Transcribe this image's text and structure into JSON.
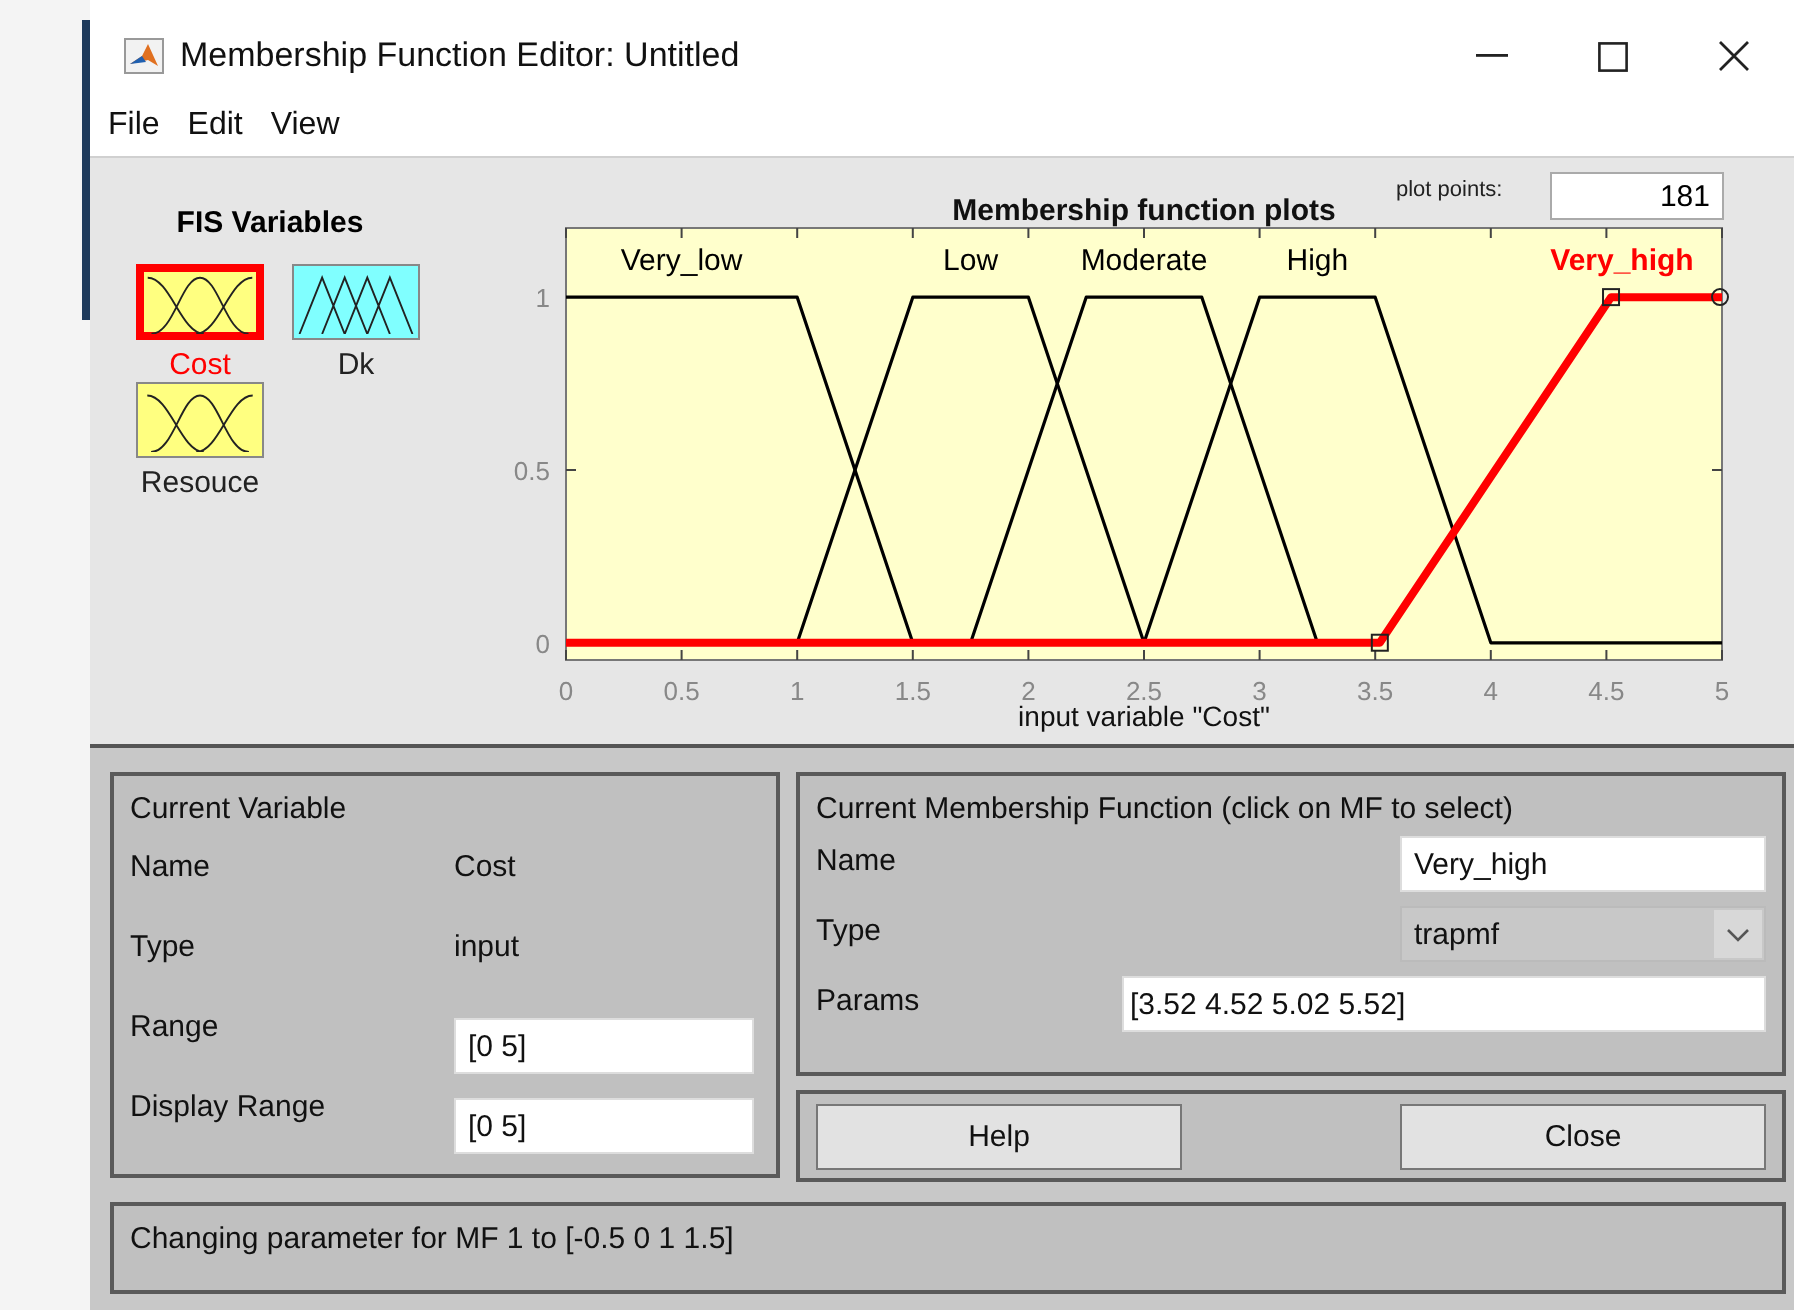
{
  "window": {
    "title": "Membership Function Editor: Untitled"
  },
  "menu": [
    {
      "label": "File"
    },
    {
      "label": "Edit"
    },
    {
      "label": "View"
    }
  ],
  "fis_variables": {
    "title": "FIS Variables",
    "items": [
      {
        "name": "Cost",
        "kind": "input",
        "selected": true
      },
      {
        "name": "Dk",
        "kind": "output",
        "selected": false
      },
      {
        "name": "Resouce",
        "kind": "input",
        "selected": false
      }
    ]
  },
  "plot_points": {
    "label": "plot points:",
    "value": "181"
  },
  "chart_data": {
    "type": "line",
    "title": "Membership function plots",
    "xlabel": "input variable \"Cost\"",
    "x": [
      0,
      1,
      1.5,
      1.75,
      2,
      2.25,
      2.5,
      2.75,
      3,
      3.25,
      3.5,
      3.52,
      4,
      4.52,
      5
    ],
    "series": [
      {
        "name": "Very_low",
        "color": "#000000",
        "values": [
          1,
          1,
          0,
          null,
          null,
          null,
          null,
          null,
          null,
          null,
          null,
          null,
          null,
          null,
          null
        ]
      },
      {
        "name": "Low",
        "color": "#000000",
        "values": [
          null,
          0,
          1,
          1,
          1,
          0.5,
          0,
          null,
          null,
          null,
          null,
          null,
          null,
          null,
          null
        ]
      },
      {
        "name": "Moderate",
        "color": "#000000",
        "values": [
          null,
          null,
          null,
          0,
          0.5,
          1,
          1,
          1,
          0.5,
          0,
          null,
          null,
          null,
          null,
          null
        ]
      },
      {
        "name": "High",
        "color": "#000000",
        "values": [
          null,
          null,
          null,
          null,
          null,
          null,
          0,
          0.5,
          1,
          1,
          1,
          0.96,
          0,
          0,
          0
        ]
      },
      {
        "name": "Very_high",
        "color": "#ff0000",
        "values": [
          0,
          0,
          0,
          0,
          0,
          0,
          0,
          0,
          0,
          0,
          0,
          0,
          0.48,
          1,
          1
        ]
      }
    ],
    "legend": "top",
    "xlim": [
      0,
      5
    ],
    "ylim": [
      -0.05,
      1.2
    ],
    "xticks": [
      0,
      0.5,
      1,
      1.5,
      2,
      2.5,
      3,
      3.5,
      4,
      4.5,
      5
    ],
    "yticks": [
      0,
      0.5,
      1
    ]
  },
  "current_variable": {
    "title": "Current Variable",
    "name_label": "Name",
    "name": "Cost",
    "type_label": "Type",
    "type": "input",
    "range_label": "Range",
    "range": "[0 5]",
    "display_range_label": "Display Range",
    "display_range": "[0 5]"
  },
  "current_mf": {
    "title": "Current Membership Function (click on MF to select)",
    "name_label": "Name",
    "name": "Very_high",
    "type_label": "Type",
    "type": "trapmf",
    "params_label": "Params",
    "params": "[3.52 4.52 5.02 5.52]"
  },
  "buttons": [
    {
      "label": "Help"
    },
    {
      "label": "Close"
    }
  ],
  "status": "Changing parameter for MF 1 to  [-0.5 0 1 1.5]"
}
